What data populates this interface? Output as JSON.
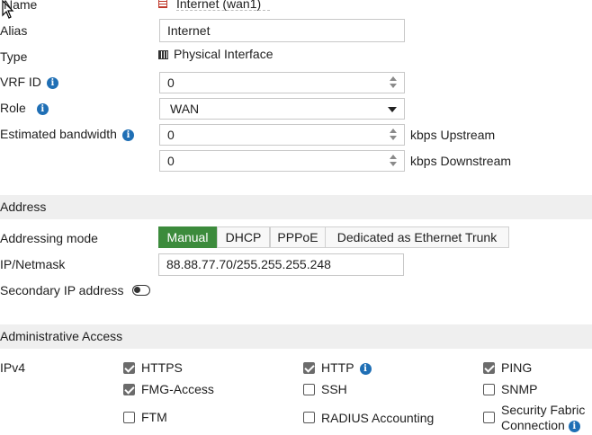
{
  "fields": {
    "name": {
      "label": "Name",
      "value": "Internet (wan1)"
    },
    "alias": {
      "label": "Alias",
      "value": "Internet"
    },
    "type": {
      "label": "Type",
      "value": "Physical Interface"
    },
    "vrf_id": {
      "label": "VRF ID",
      "value": "0"
    },
    "role": {
      "label": "Role",
      "value": "WAN"
    },
    "estimated_bandwidth": {
      "label": "Estimated bandwidth",
      "upstream_value": "0",
      "upstream_unit": "kbps Upstream",
      "downstream_value": "0",
      "downstream_unit": "kbps Downstream"
    }
  },
  "address": {
    "section_title": "Address",
    "addressing_mode_label": "Addressing mode",
    "modes": [
      "Manual",
      "DHCP",
      "PPPoE",
      "Dedicated as Ethernet Trunk"
    ],
    "selected_mode": "Manual",
    "ip_netmask_label": "IP/Netmask",
    "ip_netmask_value": "88.88.77.70/255.255.255.248",
    "secondary_ip_label": "Secondary IP address",
    "secondary_ip_enabled": false
  },
  "admin_access": {
    "section_title": "Administrative Access",
    "ipv4_label": "IPv4",
    "options": [
      {
        "label": "HTTPS",
        "checked": true
      },
      {
        "label": "HTTP",
        "checked": true
      },
      {
        "label": "PING",
        "checked": true
      },
      {
        "label": "FMG-Access",
        "checked": true
      },
      {
        "label": "SSH",
        "checked": false
      },
      {
        "label": "SNMP",
        "checked": false
      },
      {
        "label": "FTM",
        "checked": false
      },
      {
        "label": "RADIUS Accounting",
        "checked": false
      },
      {
        "label_line1": "Security Fabric",
        "label_line2": "Connection",
        "checked": false
      }
    ]
  },
  "colors": {
    "accent_green": "#3c8b3c",
    "info_blue": "#1f6fb5",
    "section_bg": "#efefef"
  },
  "icons": [
    "mouse-pointer",
    "interface-red-icon",
    "physical-interface-icon",
    "info-icon",
    "spin-arrows",
    "dropdown-caret"
  ]
}
